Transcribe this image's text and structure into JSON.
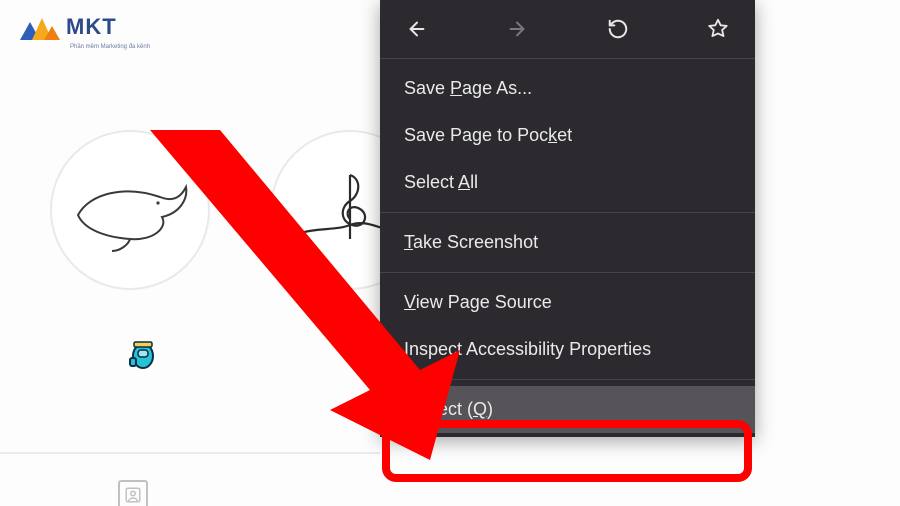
{
  "logo": {
    "text": "MKT",
    "tagline": "Phần mềm Marketing đa kênh"
  },
  "stories": {
    "whale_alt": "whale story highlight",
    "clef_alt": "music story highlight"
  },
  "context_menu": {
    "save_page_as": "Save Page As...",
    "save_to_pocket": "Save Page to Pocket",
    "select_all": "Select All",
    "take_screenshot": "Take Screenshot",
    "view_source": "View Page Source",
    "inspect_a11y": "Inspect Accessibility Properties",
    "inspect": "Inspect (Q)"
  }
}
